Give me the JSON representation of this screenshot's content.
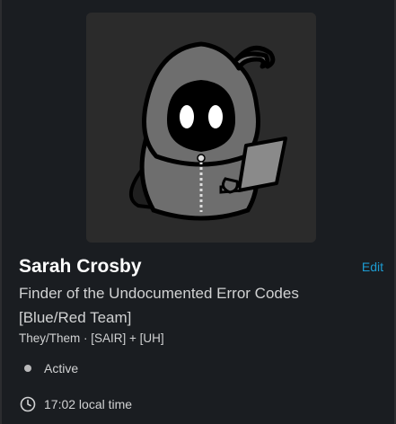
{
  "profile": {
    "name": "Sarah Crosby",
    "edit_label": "Edit",
    "title_line1": "Finder of the Undocumented Error Codes",
    "title_line2": "[Blue/Red Team]",
    "pronouns": "They/Them · [SAIR] + [UH]",
    "status": "Active",
    "local_time": "17:02 local time",
    "avatar_icon": "hooded-figure-with-laptop",
    "status_icon": "presence-dot-icon",
    "time_icon": "clock-icon"
  },
  "colors": {
    "background": "#1a1d21",
    "name": "#ffffff",
    "text": "#d1d2d3",
    "link": "#1d9bd1",
    "presence_dot": "#b9b9ba"
  }
}
